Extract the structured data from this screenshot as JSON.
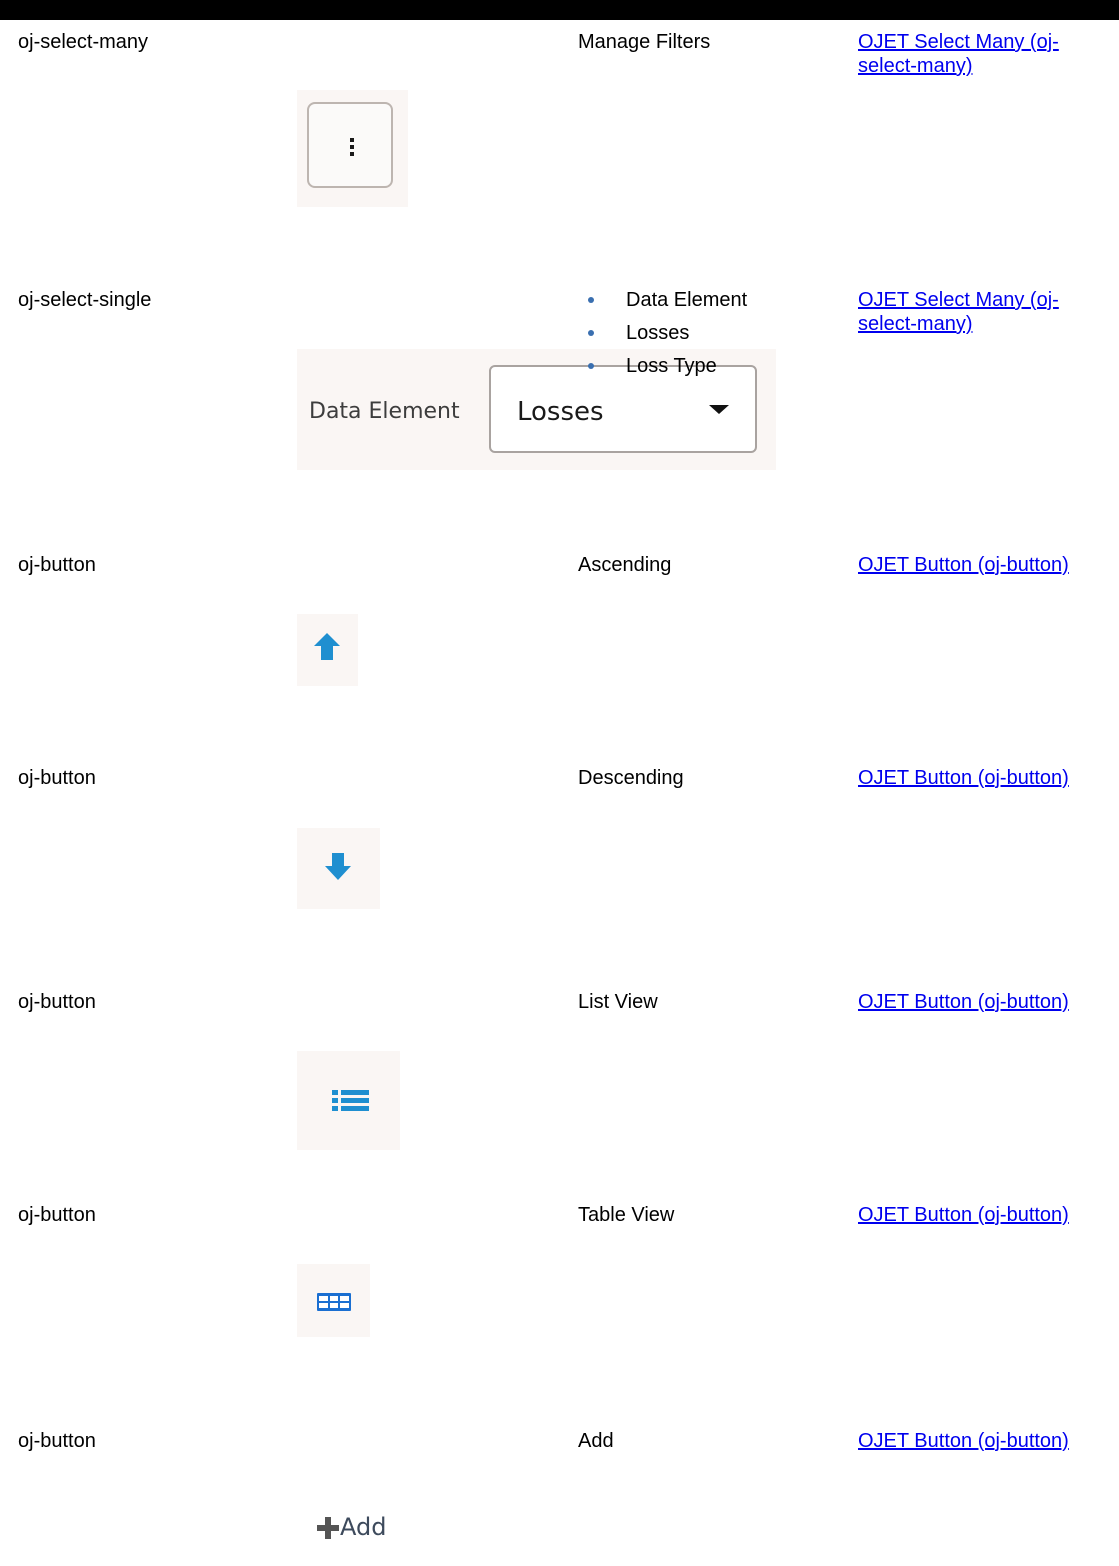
{
  "rows": [
    {
      "component": "oj-select-many",
      "description": "Manage Filters",
      "link": "OJET Select Many (oj-select-many)",
      "link_line1": "OJET Select Many (oj-",
      "link_line2": "select-many)"
    },
    {
      "component": "oj-select-single",
      "description_items": [
        "Data Element",
        "Losses",
        "Loss Type"
      ],
      "link_line1": "OJET Select Many (oj-",
      "link_line2": "select-many)",
      "shot": {
        "label": "Data Element",
        "value": "Losses"
      }
    },
    {
      "component": "oj-button",
      "description": "Ascending",
      "link": "OJET Button (oj-button)"
    },
    {
      "component": "oj-button",
      "description": "Descending",
      "link": "OJET Button (oj-button)"
    },
    {
      "component": "oj-button",
      "description": "List View",
      "link": "OJET Button (oj-button)"
    },
    {
      "component": "oj-button",
      "description": "Table View",
      "link": "OJET Button (oj-button)"
    },
    {
      "component": "oj-button",
      "description": "Add",
      "link": "OJET Button (oj-button)",
      "shot": {
        "label": "Add"
      }
    }
  ],
  "icons": {
    "manage_filters": "kebab-icon",
    "ascending": "arrow-up-icon",
    "descending": "arrow-down-icon",
    "list_view": "list-icon",
    "table_view": "table-grid-icon",
    "add": "plus-icon"
  },
  "colors": {
    "link": "#0000ee",
    "icon_blue": "#1f8fd0",
    "table_icon_blue": "#1a6fd1",
    "bullet": "#3a6fb0"
  }
}
